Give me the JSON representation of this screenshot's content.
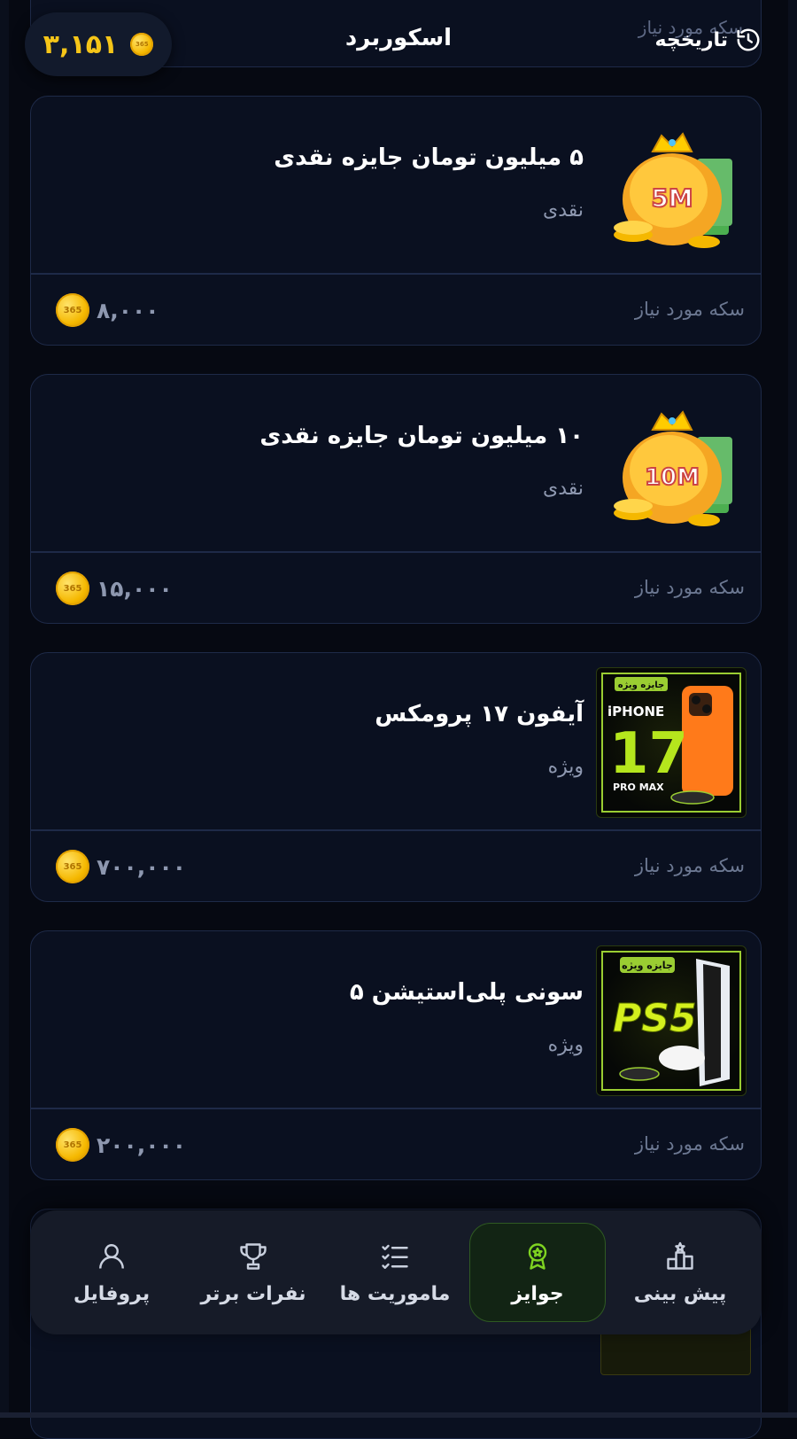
{
  "header": {
    "coin_balance": "۳,۱۵۱",
    "coin_badge": "365",
    "title": "اسکوربرد",
    "history_label": "تاریخچه"
  },
  "top_card": {
    "faded_label": "سکه مورد نیاز"
  },
  "prizes": [
    {
      "title": "۵ میلیون تومان جایزه نقدی",
      "category": "نقدی",
      "required_label": "سکه مورد نیاز",
      "cost": "۸,۰۰۰",
      "badge": "5M"
    },
    {
      "title": "۱۰ میلیون تومان جایزه نقدی",
      "category": "نقدی",
      "required_label": "سکه مورد نیاز",
      "cost": "۱۵,۰۰۰",
      "badge": "10M"
    },
    {
      "title": "آیفون ۱۷ پرومکس",
      "category": "ویژه",
      "required_label": "سکه مورد نیاز",
      "cost": "۷۰۰,۰۰۰",
      "badge": "iPHONE 17 PRO MAX",
      "badge_tag": "جایزه ویژه"
    },
    {
      "title": "سونی پلی‌استیشن ۵",
      "category": "ویژه",
      "required_label": "سکه مورد نیاز",
      "cost": "۲۰۰,۰۰۰",
      "badge": "PS5",
      "badge_tag": "جایزه ویژه"
    }
  ],
  "coin_badge": "365",
  "nav": [
    {
      "label": "پیش بینی",
      "icon": "podium-icon",
      "active": false
    },
    {
      "label": "جوایز",
      "icon": "award-icon",
      "active": true
    },
    {
      "label": "ماموریت ها",
      "icon": "checklist-icon",
      "active": false
    },
    {
      "label": "نفرات برتر",
      "icon": "trophy-icon",
      "active": false
    },
    {
      "label": "پروفایل",
      "icon": "user-icon",
      "active": false
    }
  ],
  "colors": {
    "background": "#060912",
    "card": "#0a1020",
    "border": "#1e2a48",
    "coin_gold": "#f5c518",
    "active_green": "#7ed321",
    "muted_text": "#8e98b0"
  }
}
